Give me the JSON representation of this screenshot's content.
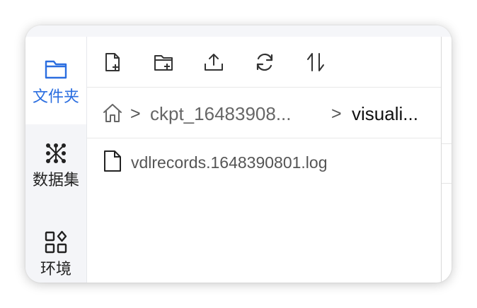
{
  "sidebar": {
    "items": [
      {
        "label": "文件夹",
        "icon": "folder-icon",
        "active": true
      },
      {
        "label": "数据集",
        "icon": "dataset-icon",
        "active": false
      },
      {
        "label": "环境",
        "icon": "environment-icon",
        "active": false
      }
    ]
  },
  "toolbar": {
    "buttons": [
      {
        "icon": "new-file-icon"
      },
      {
        "icon": "new-folder-icon"
      },
      {
        "icon": "upload-icon"
      },
      {
        "icon": "refresh-icon"
      },
      {
        "icon": "sort-icon"
      }
    ]
  },
  "breadcrumb": {
    "home_icon": "home-icon",
    "separator": ">",
    "items": [
      "ckpt_16483908...",
      "visuali..."
    ]
  },
  "files": [
    {
      "name": "vdlrecords.1648390801.log",
      "icon": "file-icon"
    }
  ],
  "colors": {
    "accent": "#2b6ee0",
    "sidebar_bg": "#f4f5f8",
    "text": "#222222"
  }
}
